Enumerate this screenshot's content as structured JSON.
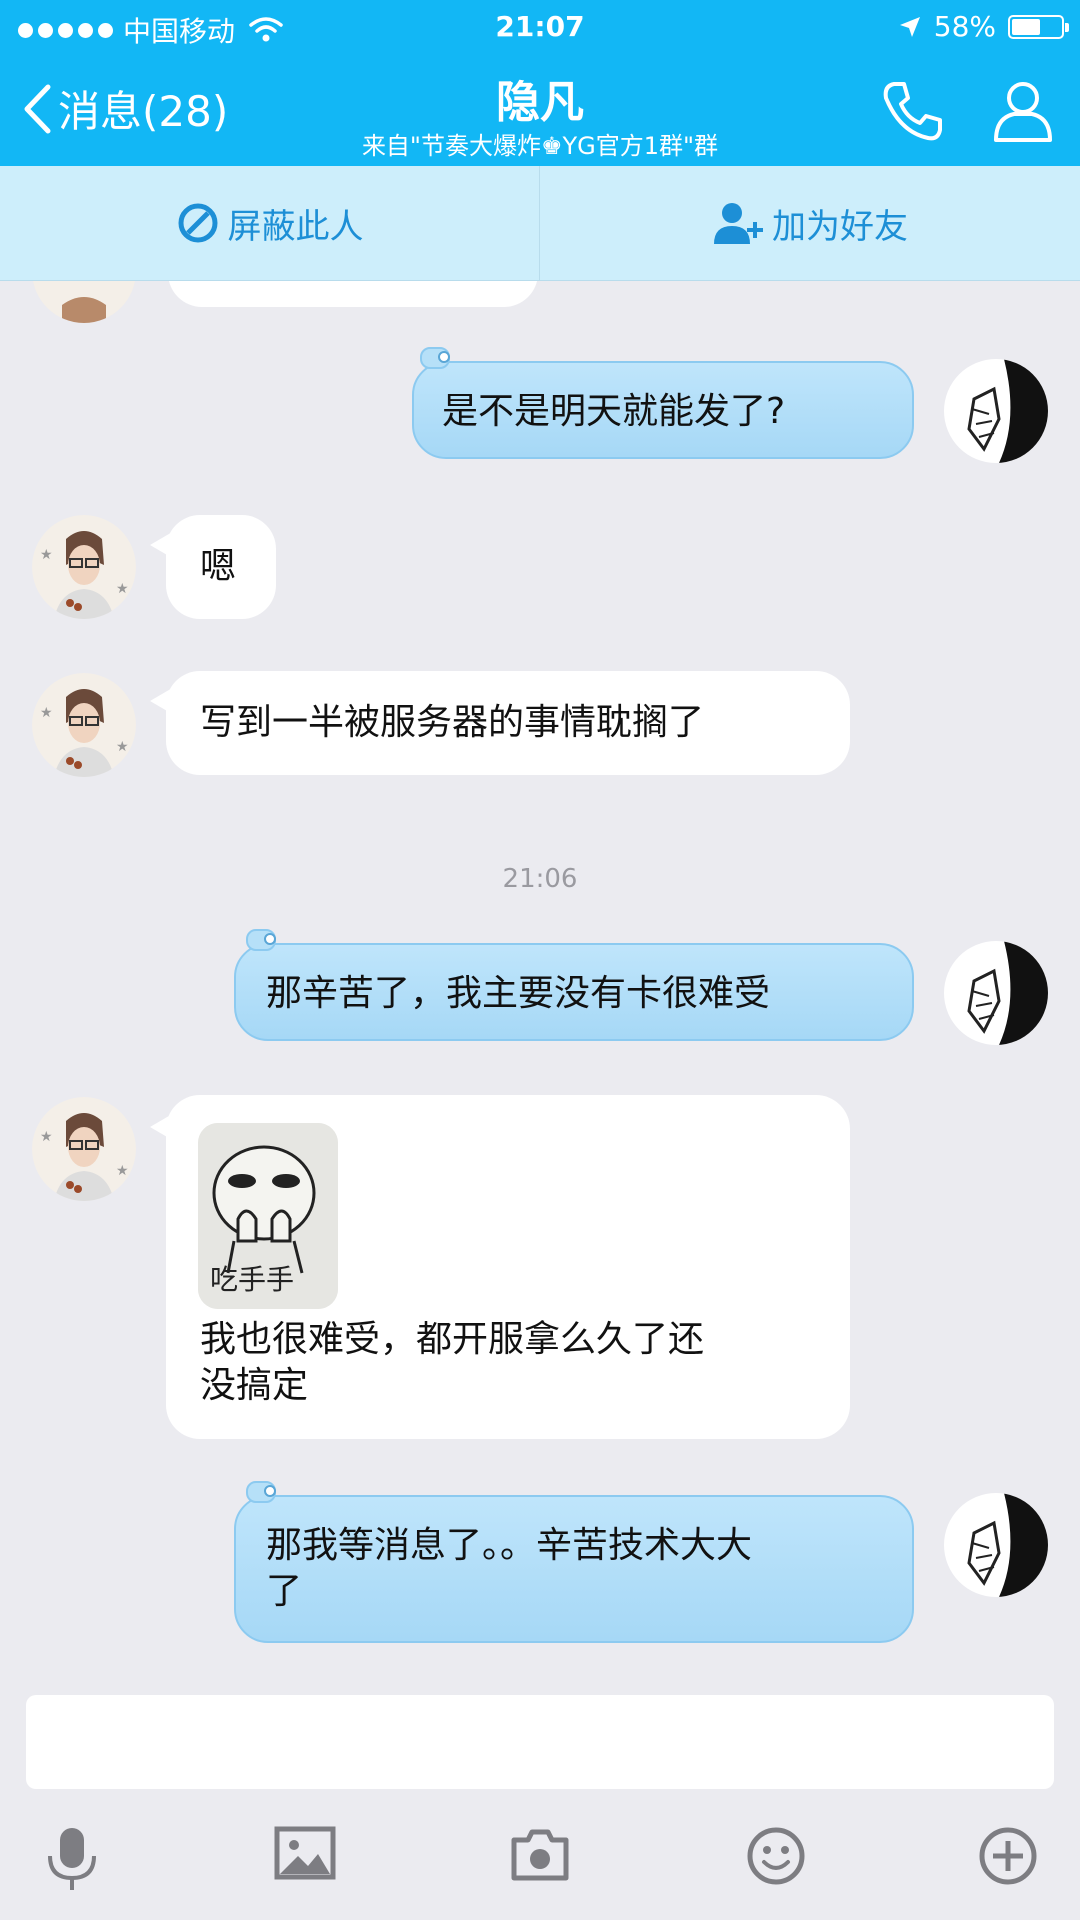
{
  "status_bar": {
    "carrier": "中国移动",
    "time": "21:07",
    "battery": "58%",
    "battery_level": 0.58
  },
  "nav": {
    "back_label": "消息(28)",
    "title": "隐凡",
    "subtitle": "来自\"节奏大爆炸♚YG官方1群\"群"
  },
  "actions": {
    "block": "屏蔽此人",
    "add_friend": "加为好友"
  },
  "messages": [
    {
      "side": "out",
      "text": "是不是明天就能发了?"
    },
    {
      "side": "in",
      "text": "嗯"
    },
    {
      "side": "in",
      "text": "写到一半被服务器的事情耽搁了"
    },
    {
      "side": "out",
      "text": "那辛苦了，我主要没有卡很难受"
    },
    {
      "side": "in",
      "sticker_caption": "吃手手",
      "line1": "我也很难受，都开服拿么久了还",
      "line2": "没搞定"
    },
    {
      "side": "out",
      "line1": "那我等消息了。。辛苦技术大大",
      "line2": "了"
    }
  ],
  "timestamp": "21:06",
  "toolbar": {
    "icons": [
      "microphone-icon",
      "image-icon",
      "camera-icon",
      "emoji-icon",
      "plus-icon"
    ]
  },
  "colors": {
    "header": "#12b7f5",
    "action_bar": "#cdeefb",
    "outgoing_bubble": "#a6d8f6",
    "incoming_bubble": "#ffffff",
    "chat_bg": "#ebebf0"
  }
}
